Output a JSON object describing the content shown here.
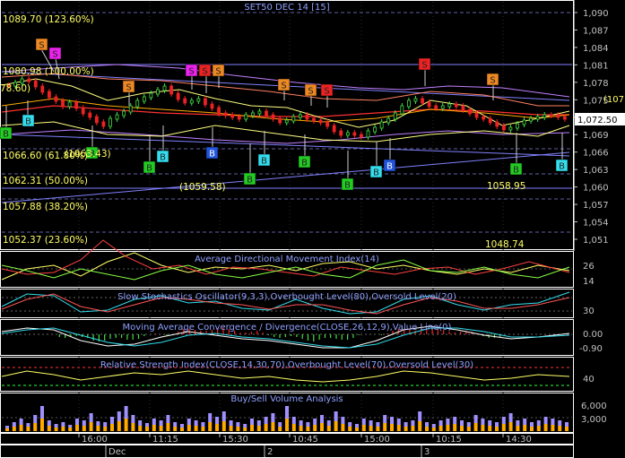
{
  "title": "SET50 DEC 14   [15]",
  "colors": {
    "background": "#000000",
    "frame": "#ffffff",
    "price_axis": "#c0c0c0",
    "fib_text": "#ffff66",
    "candle_up": "#44dd44",
    "candle_down": "#ee2222",
    "ma_red": "#ff3030",
    "ma_yellow": "#ffff80",
    "ma_orange": "#ffaa00",
    "envelope": "#c080ff",
    "trendline": "#8080ff",
    "panel_title": "#8fa0ff",
    "signal_orange": "#ee8822",
    "signal_red": "#ee2222",
    "signal_magenta": "#ee22ee",
    "signal_green": "#22cc22",
    "signal_cyan": "#33ddee",
    "signal_blue": "#2255dd"
  },
  "fib_levels": [
    {
      "label": "1089.70 (123.60%)",
      "value": 1089.7
    },
    {
      "label": "1080.98 (100.00%)",
      "value": 1080.98
    },
    {
      "label": "1066.60 (61.80%)",
      "value": 1066.6
    },
    {
      "label": "1062.31 (50.00%)",
      "value": 1062.31
    },
    {
      "label": "1057.88 (38.20%)",
      "value": 1057.88
    },
    {
      "label": "1052.37 (23.60%)",
      "value": 1052.37
    }
  ],
  "fib_fragments": [
    "78.60)",
    "(1063.43)"
  ],
  "price_annotations": [
    {
      "label": "(1059.58)"
    },
    {
      "label": "1058.95"
    },
    {
      "label": "1048.74"
    }
  ],
  "price_axis_ticks": [
    "1,090",
    "1,087",
    "1,084",
    "1,081",
    "1,078",
    "1,075",
    "1,072",
    "1,069",
    "1,066",
    "1,063",
    "1,060",
    "1,057",
    "1,054",
    "1,051"
  ],
  "price_axis_values": [
    1090,
    1087,
    1084,
    1081,
    1078,
    1075,
    1072,
    1069,
    1066,
    1063,
    1060,
    1057,
    1054,
    1051
  ],
  "current_price": "1,072.50",
  "current_price_value": 1072.5,
  "clipped_label": "(107",
  "panels": {
    "adx": {
      "title": "Average Directional Movement Index(14)",
      "ticks": [
        "26",
        "14"
      ]
    },
    "stoch": {
      "title": "Slow Stochastics Oscillator(9,3,3),Overbought Level(80),Oversold Level(20)",
      "ticks": [
        "30"
      ]
    },
    "macd": {
      "title": "Moving Average Convergence / Divergence(CLOSE,26,12,9),Value Line(0)",
      "ticks": [
        "0.00",
        "-0.90"
      ]
    },
    "rsi": {
      "title": "Relative Strength Index(CLOSE,14,30,70),Overbought Level(70),Oversold Level(30)",
      "ticks": [
        "40"
      ]
    },
    "volume": {
      "title": "Buy/Sell Volume Analysis",
      "ticks": [
        "6,000",
        "3,000"
      ]
    }
  },
  "time_axis": {
    "times": [
      "16:00",
      "11:15",
      "15:30",
      "10:45",
      "15:00",
      "10:15",
      "14:30"
    ],
    "dates": [
      "Dec",
      "2",
      "3"
    ]
  },
  "signals": [
    {
      "letter": "S",
      "color": "signal_orange"
    },
    {
      "letter": "S",
      "color": "signal_magenta"
    },
    {
      "letter": "S",
      "color": "signal_orange"
    },
    {
      "letter": "S",
      "color": "signal_magenta"
    },
    {
      "letter": "S",
      "color": "signal_red"
    },
    {
      "letter": "S",
      "color": "signal_orange"
    },
    {
      "letter": "S",
      "color": "signal_orange"
    },
    {
      "letter": "S",
      "color": "signal_orange"
    },
    {
      "letter": "S",
      "color": "signal_red"
    },
    {
      "letter": "S",
      "color": "signal_orange"
    },
    {
      "letter": "S",
      "color": "signal_red"
    },
    {
      "letter": "B",
      "color": "signal_green"
    },
    {
      "letter": "B",
      "color": "signal_cyan"
    },
    {
      "letter": "B",
      "color": "signal_green"
    },
    {
      "letter": "B",
      "color": "signal_green"
    },
    {
      "letter": "B",
      "color": "signal_cyan"
    },
    {
      "letter": "B",
      "color": "signal_blue"
    },
    {
      "letter": "B",
      "color": "signal_green"
    },
    {
      "letter": "B",
      "color": "signal_cyan"
    },
    {
      "letter": "B",
      "color": "signal_green"
    },
    {
      "letter": "B",
      "color": "signal_green"
    },
    {
      "letter": "B",
      "color": "signal_cyan"
    },
    {
      "letter": "B",
      "color": "signal_blue"
    },
    {
      "letter": "B",
      "color": "signal_green"
    },
    {
      "letter": "B",
      "color": "signal_cyan"
    }
  ]
}
